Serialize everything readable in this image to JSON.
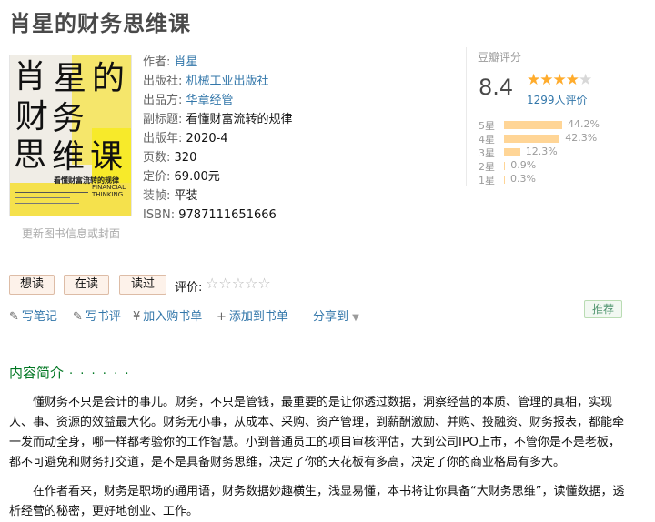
{
  "title": "肖星的财务思维课",
  "cover": {
    "chars": [
      "肖",
      "星",
      "的",
      "财",
      "务",
      "思",
      "维",
      "课"
    ],
    "subtitle": "看懂财富流转的规律",
    "english": "FINANCIAL THINKING"
  },
  "update_link": "更新图书信息或封面",
  "info": {
    "author_label": "作者:",
    "author": "肖星",
    "publisher_label": "出版社:",
    "publisher": "机械工业出版社",
    "producer_label": "出品方:",
    "producer": "华章经管",
    "subtitle_label": "副标题:",
    "subtitle": "看懂财富流转的规律",
    "year_label": "出版年:",
    "year": "2020-4",
    "pages_label": "页数:",
    "pages": "320",
    "price_label": "定价:",
    "price": "69.00元",
    "binding_label": "装帧:",
    "binding": "平装",
    "isbn_label": "ISBN:",
    "isbn": "9787111651666"
  },
  "rating": {
    "title": "豆瓣评分",
    "score": "8.4",
    "stars": 4.5,
    "count": "1299人评价",
    "distribution": [
      {
        "label": "5星",
        "pct": "44.2%",
        "value": 44.2
      },
      {
        "label": "4星",
        "pct": "42.3%",
        "value": 42.3
      },
      {
        "label": "3星",
        "pct": "12.3%",
        "value": 12.3
      },
      {
        "label": "2星",
        "pct": "0.9%",
        "value": 0.9
      },
      {
        "label": "1星",
        "pct": "0.3%",
        "value": 0.3
      }
    ]
  },
  "buttons": {
    "want": "想读",
    "doing": "在读",
    "done": "读过",
    "rate_label": "评价:"
  },
  "actions": {
    "note": "写笔记",
    "review": "写书评",
    "cart": "加入购书单",
    "list": "添加到书单",
    "share": "分享到"
  },
  "recommend": "推荐",
  "intro": {
    "heading": "内容简介",
    "dots": "· · · · · ·",
    "p1": "懂财务不只是会计的事儿。财务，不只是管钱，最重要的是让你透过数据，洞察经营的本质、管理的真相，实现人、事、资源的效益最大化。财务无小事，从成本、采购、资产管理，到薪酬激励、并购、投融资、财务报表，都能牵一发而动全身，哪一样都考验你的工作智慧。小到普通员工的项目审核评估，大到公司IPO上市，不管你是不是老板，都不可避免和财务打交道，是不是具备财务思维，决定了你的天花板有多高，决定了你的商业格局有多大。",
    "p2": "在作者看来，财务是职场的通用语，财务数据妙趣横生，浅显易懂，本书将让你具备“大财务思维”，读懂数据，透析经营的秘密，更好地创业、工作。"
  }
}
